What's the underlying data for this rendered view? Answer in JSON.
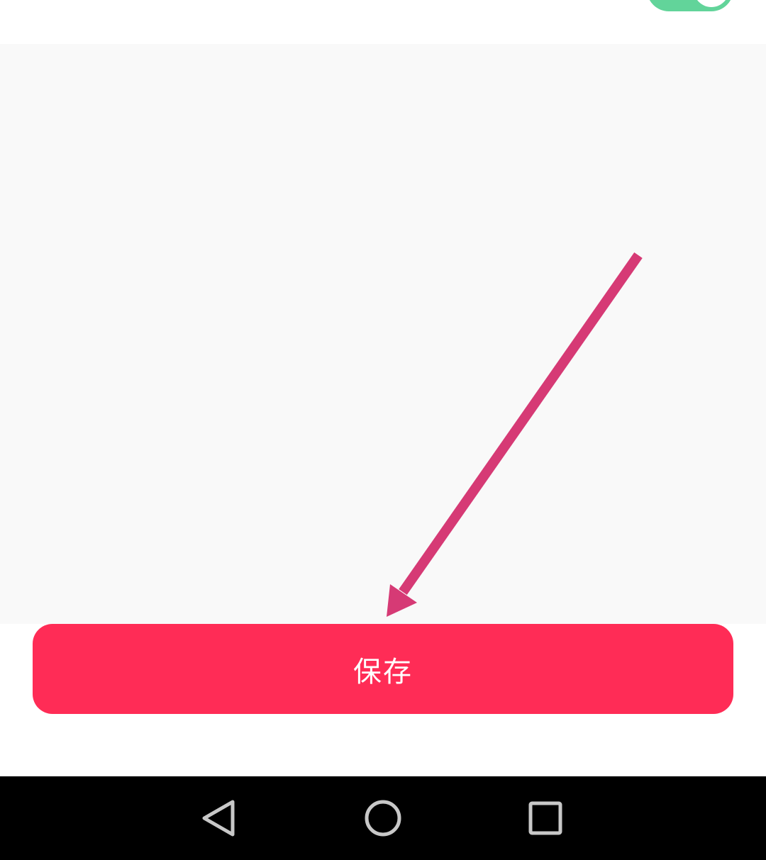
{
  "settings_row": {
    "label": "",
    "toggle_on": true,
    "toggle_color": "#62d49a"
  },
  "save_button": {
    "label": "保存",
    "color": "#ff2c56"
  },
  "annotation": {
    "arrow_color": "#d63a75"
  },
  "nav_bar": {
    "back_icon": "back-triangle-icon",
    "home_icon": "home-circle-icon",
    "recent_icon": "recent-apps-square-icon"
  }
}
